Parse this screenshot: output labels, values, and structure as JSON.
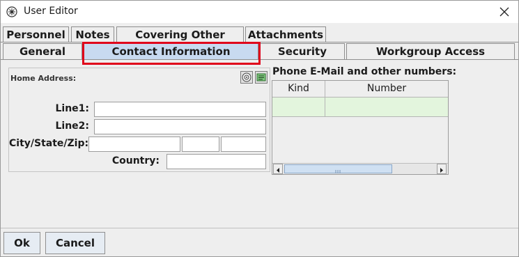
{
  "window": {
    "title": "User Editor",
    "icon": "app-logo-icon",
    "close_icon": "close-icon"
  },
  "tabs_top": [
    {
      "label": "Personnel"
    },
    {
      "label": "Notes"
    },
    {
      "label": "Covering Other Users"
    },
    {
      "label": "Attachments"
    }
  ],
  "tabs_bottom": [
    {
      "label": "General"
    },
    {
      "label": "Contact Information",
      "selected": true
    },
    {
      "label": "Security"
    },
    {
      "label": "Workgroup Access"
    }
  ],
  "home_address": {
    "title": "Home Address:",
    "line1_label": "Line1:",
    "line1_value": "",
    "line2_label": "Line2:",
    "line2_value": "",
    "city_state_zip_label": "City/State/Zip:",
    "city_value": "",
    "state_value": "",
    "zip_value": "",
    "country_label": "Country:",
    "country_value": "",
    "mini_buttons": [
      "globe-icon",
      "card-icon"
    ]
  },
  "phone_section": {
    "title": "Phone E-Mail and other numbers:",
    "columns": [
      "Kind",
      "Number"
    ],
    "rows": [
      {
        "kind": "",
        "number": ""
      }
    ]
  },
  "buttons": {
    "ok": "Ok",
    "cancel": "Cancel"
  },
  "colors": {
    "selected_tab": "#c8daf0",
    "row_highlight": "#e3f5dd",
    "annotation_outline": "#e0001a"
  }
}
